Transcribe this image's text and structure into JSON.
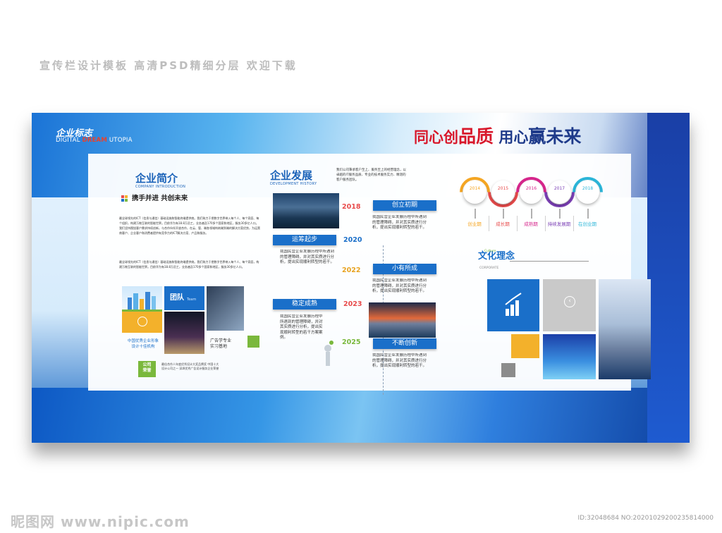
{
  "caption": "宣传栏设计模板 高清PSD精细分层 欢迎下载",
  "logo": {
    "title": "企业标志",
    "sub_pre": "DIGITAL ",
    "sub_dream": "DREAM",
    "sub_post": " UTOPIA"
  },
  "slogan": {
    "p1": "同心创",
    "p2": "品质",
    "p3": " 用心",
    "p4": "赢",
    "p5": "未来"
  },
  "intro": {
    "title": "企业简介",
    "sub": "COMPANY INTRODUCTION",
    "motto": "携手并进 共创未来",
    "para1": "最全球领先的ICT（信息与通信）基础设施和智能终端提供商。我们致力于把数字世界带入每个人、每个家庭、每个组织，构建万物互联的智能世界。目前华为有18.8万员工，业务遍及170多个国家和地区，服务30多亿人口。我们坚持围绕客户需求持续创新，与合作伙伴开放合作，在云、管、端各领域构筑端到端的解决方案优势，为运营商客户、企业客户和消费者提供有竞争力的ICT解决方案、产品和服务。",
    "para2": "最全球领先的ICT（信息与通信）基础设施和智能终端提供商。我们致力于把数字世界带入每个人、每个家庭，构建万物互联的智能世界。目前华为有18.8万员工，业务遍及170多个国家和地区，服务30多亿人口。",
    "team_label": "团队",
    "team_sub": "Team",
    "award_line1": "中国优秀企业形象",
    "award_line2": "设计十佳机构",
    "base_line1": "广告学专业",
    "base_line2": "实习基地",
    "honor_line1": "公司",
    "honor_line2": "荣誉",
    "honor_text": "最佳合作人年度优秀设计大奖品牌奖 中国十大设计公司之一 深圳优秀广告设计服务企业荣誉"
  },
  "dev": {
    "title": "企业发展",
    "sub": "DEVELOPMENT HISTORY",
    "intro": "我们公司秉承客户至上、服务至上的经营理念，以卓越的IT服务品质、专业的技术服务实力、精湛的客户服务团队。",
    "entries": [
      {
        "year": "2018",
        "stage": "创立初期",
        "text": "我国民营企业发展历程中所遇到的管理障碍，并对其实质进行分析，提出实现顺利转型的若干。"
      },
      {
        "year": "2020",
        "stage": "运筹起步",
        "text": "我国民营企业发展历程中所遇到的管理障碍，并对其实质进行分析，提出实现顺利转型的若干。"
      },
      {
        "year": "2022",
        "stage": "小有所成",
        "text": "我国民营企业发展历程中所遇到的管理障碍，并对其实质进行分析，提出实现顺利转型的若干。"
      },
      {
        "year": "2023",
        "stage": "稳定成熟",
        "text": "我国民营企业发展历程中所遇到的管理障碍，并对其实质进行分析，提出实现顺利转型的若干方案案例。"
      },
      {
        "year": "2025",
        "stage": "不断创新",
        "text": "我国民营企业发展历程中所遇到的管理障碍，并对其实质进行分析，提出实现顺利转型的若干。"
      }
    ]
  },
  "phases": [
    {
      "year": "2014",
      "label": "创业期",
      "color": "#f5a623"
    },
    {
      "year": "2015",
      "label": "成长期",
      "color": "#e84b4b"
    },
    {
      "year": "2016",
      "label": "成熟期",
      "color": "#d6278c"
    },
    {
      "year": "2017",
      "label": "持续发展期",
      "color": "#7b3fb5"
    },
    {
      "year": "2018",
      "label": "在创业期",
      "color": "#2bb5d8"
    }
  ],
  "culture": {
    "title": "文化理念",
    "small": "Culture",
    "sub": "CORPORATE"
  },
  "footer": {
    "watermark": "昵图网 www.nipic.com",
    "id_line": "ID:32048684 NO:20201029200235814000"
  },
  "colors": {
    "brand_blue": "#1a6fc9",
    "accent_red": "#d8182b",
    "green": "#7ab83c",
    "yellow": "#f3b12b"
  }
}
